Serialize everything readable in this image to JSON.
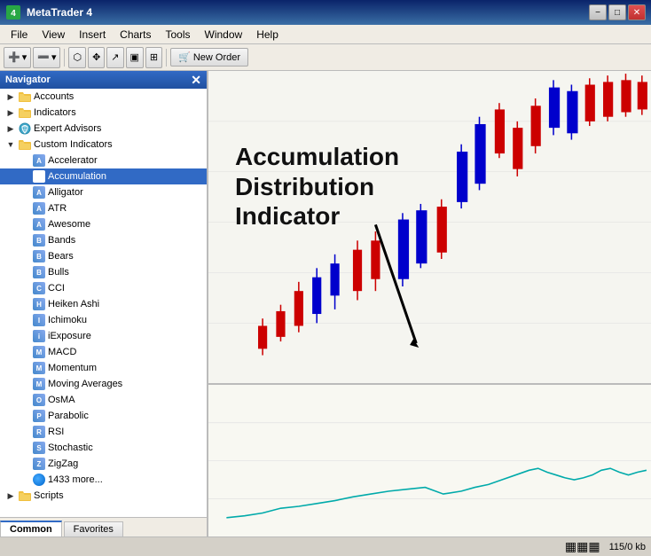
{
  "window": {
    "title": "MetaTrader 4",
    "icon": "MT4"
  },
  "titlebar": {
    "minimize": "−",
    "restore": "□",
    "close": "✕"
  },
  "menubar": {
    "items": [
      "File",
      "View",
      "Insert",
      "Charts",
      "Tools",
      "Window",
      "Help"
    ]
  },
  "toolbar": {
    "new_order_label": "New Order"
  },
  "navigator": {
    "title": "Navigator",
    "tree": [
      {
        "id": "accounts",
        "label": "Accounts",
        "level": 1,
        "expanded": false,
        "type": "folder"
      },
      {
        "id": "indicators",
        "label": "Indicators",
        "level": 1,
        "expanded": false,
        "type": "folder"
      },
      {
        "id": "expert_advisors",
        "label": "Expert Advisors",
        "level": 1,
        "expanded": false,
        "type": "folder"
      },
      {
        "id": "custom_indicators",
        "label": "Custom Indicators",
        "level": 1,
        "expanded": true,
        "type": "folder"
      },
      {
        "id": "accelerator",
        "label": "Accelerator",
        "level": 2,
        "type": "indicator"
      },
      {
        "id": "accumulation",
        "label": "Accumulation",
        "level": 2,
        "type": "indicator",
        "selected": true
      },
      {
        "id": "alligator",
        "label": "Alligator",
        "level": 2,
        "type": "indicator"
      },
      {
        "id": "atr",
        "label": "ATR",
        "level": 2,
        "type": "indicator"
      },
      {
        "id": "awesome",
        "label": "Awesome",
        "level": 2,
        "type": "indicator"
      },
      {
        "id": "bands",
        "label": "Bands",
        "level": 2,
        "type": "indicator"
      },
      {
        "id": "bears",
        "label": "Bears",
        "level": 2,
        "type": "indicator"
      },
      {
        "id": "bulls",
        "label": "Bulls",
        "level": 2,
        "type": "indicator"
      },
      {
        "id": "cci",
        "label": "CCI",
        "level": 2,
        "type": "indicator"
      },
      {
        "id": "heiken_ashi",
        "label": "Heiken Ashi",
        "level": 2,
        "type": "indicator"
      },
      {
        "id": "ichimoku",
        "label": "Ichimoku",
        "level": 2,
        "type": "indicator"
      },
      {
        "id": "iexposure",
        "label": "iExposure",
        "level": 2,
        "type": "indicator"
      },
      {
        "id": "macd",
        "label": "MACD",
        "level": 2,
        "type": "indicator"
      },
      {
        "id": "momentum",
        "label": "Momentum",
        "level": 2,
        "type": "indicator"
      },
      {
        "id": "moving_averages",
        "label": "Moving Averages",
        "level": 2,
        "type": "indicator"
      },
      {
        "id": "osma",
        "label": "OsMA",
        "level": 2,
        "type": "indicator"
      },
      {
        "id": "parabolic",
        "label": "Parabolic",
        "level": 2,
        "type": "indicator"
      },
      {
        "id": "rsi",
        "label": "RSI",
        "level": 2,
        "type": "indicator"
      },
      {
        "id": "stochastic",
        "label": "Stochastic",
        "level": 2,
        "type": "indicator"
      },
      {
        "id": "zigzag",
        "label": "ZigZag",
        "level": 2,
        "type": "indicator"
      },
      {
        "id": "more",
        "label": "1433 more...",
        "level": 2,
        "type": "indicator"
      },
      {
        "id": "scripts",
        "label": "Scripts",
        "level": 1,
        "expanded": false,
        "type": "folder"
      }
    ],
    "tabs": [
      {
        "id": "common",
        "label": "Common",
        "active": true
      },
      {
        "id": "favorites",
        "label": "Favorites",
        "active": false
      }
    ]
  },
  "annotation": {
    "line1": "Accumulation",
    "line2": "Distribution",
    "line3": "Indicator"
  },
  "statusbar": {
    "memory": "115/0 kb"
  }
}
